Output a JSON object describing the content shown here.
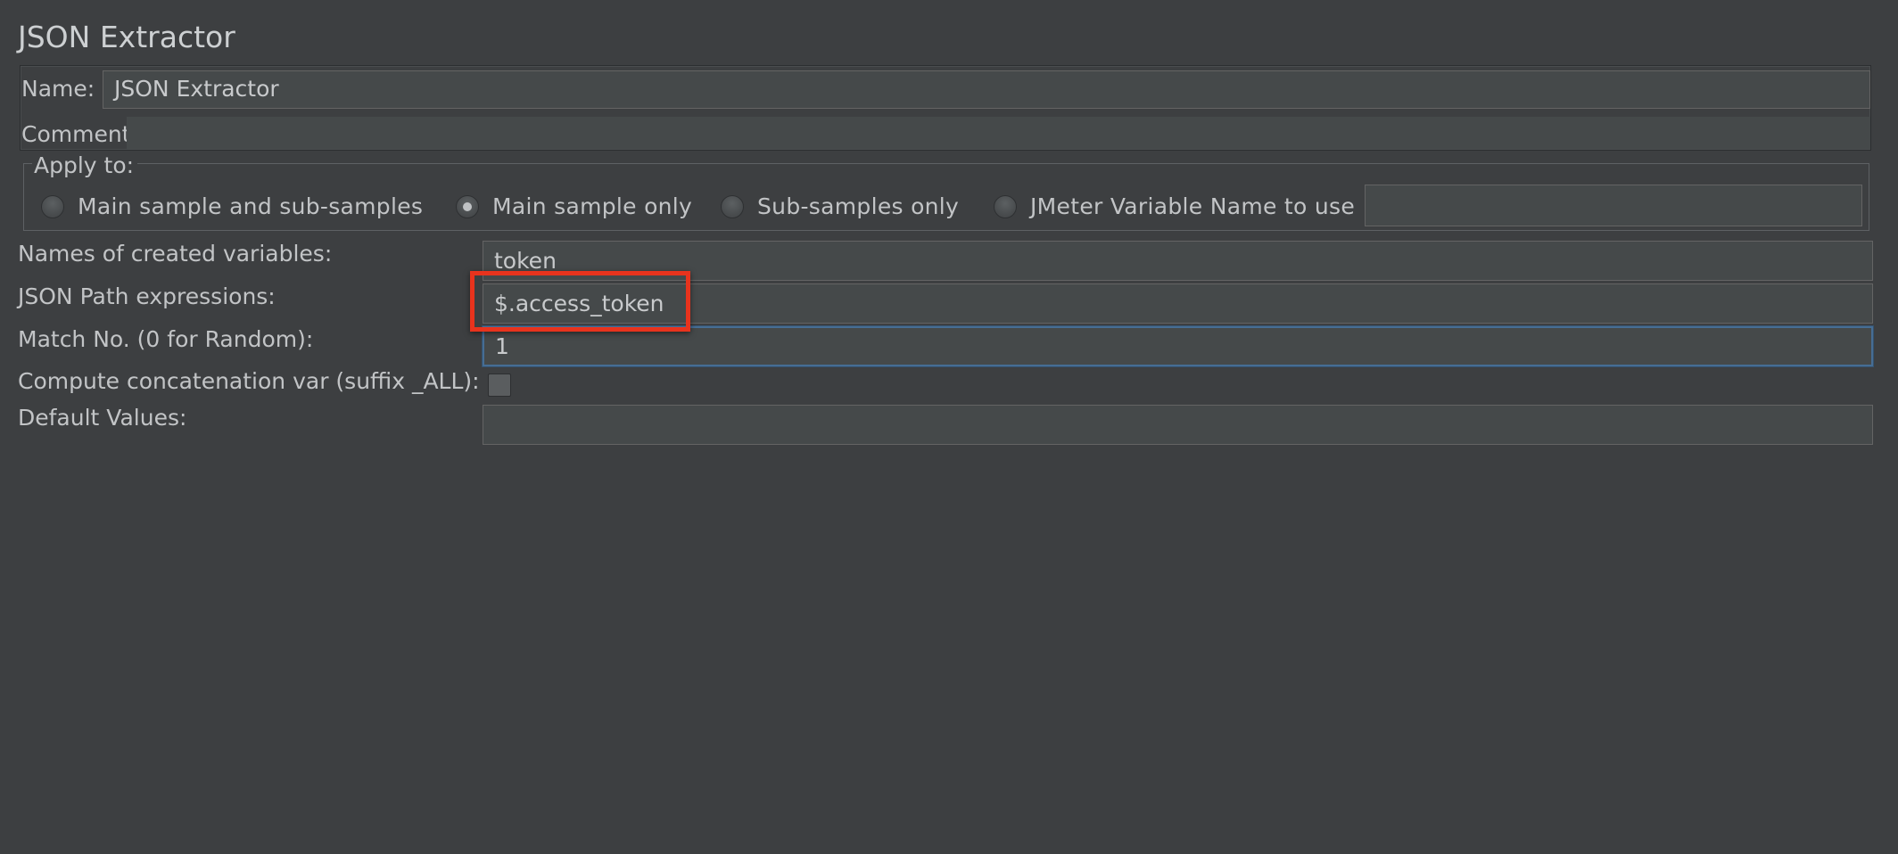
{
  "title": "JSON Extractor",
  "name_label": "Name:",
  "name_value": "JSON Extractor",
  "comments_label": "Comments:",
  "comments_value": "",
  "apply_to": {
    "legend": "Apply to:",
    "options": [
      {
        "label": "Main sample and sub-samples",
        "checked": false
      },
      {
        "label": "Main sample only",
        "checked": true
      },
      {
        "label": "Sub-samples only",
        "checked": false
      },
      {
        "label": "JMeter Variable Name to use",
        "checked": false
      }
    ],
    "variable_name_value": ""
  },
  "fields": {
    "variables_label": "Names of created variables:",
    "variables_value": "token",
    "json_path_label": "JSON Path expressions:",
    "json_path_value": "$.access_token",
    "match_no_label": "Match No. (0 for Random):",
    "match_no_value": "1",
    "concat_label": "Compute concatenation var (suffix _ALL):",
    "concat_checked": false,
    "default_label": "Default Values:",
    "default_value": ""
  },
  "colors": {
    "background": "#3d3f41",
    "field_background": "#45494a",
    "focus_border": "#466d94",
    "highlight": "#e8331d"
  }
}
